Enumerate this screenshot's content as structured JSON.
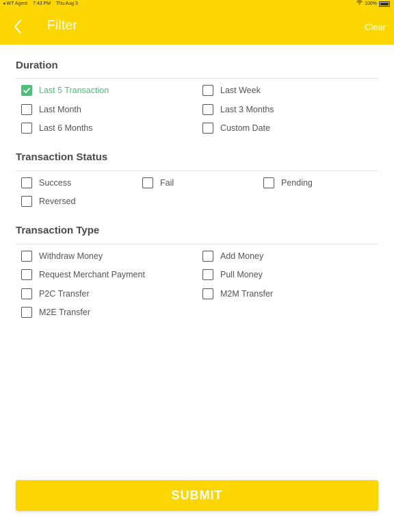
{
  "status_bar": {
    "carrier": "◂ WT Agent",
    "time": "7:43 PM",
    "date": "Thu Aug 3",
    "battery": "100%"
  },
  "header": {
    "title": "Filter",
    "clear_label": "Clear",
    "back_icon": "chevron-left-icon"
  },
  "colors": {
    "accent": "#FBD603",
    "checked": "#4FBE79",
    "text": "#555555"
  },
  "duration": {
    "title": "Duration",
    "options": [
      {
        "label": "Last 5 Transaction",
        "checked": true
      },
      {
        "label": "Last Week",
        "checked": false
      },
      {
        "label": "Last Month",
        "checked": false
      },
      {
        "label": "Last 3 Months",
        "checked": false
      },
      {
        "label": "Last 6 Months",
        "checked": false
      },
      {
        "label": "Custom Date",
        "checked": false
      }
    ]
  },
  "status": {
    "title": "Transaction Status",
    "options": [
      {
        "label": "Success",
        "checked": false
      },
      {
        "label": "Fail",
        "checked": false
      },
      {
        "label": "Pending",
        "checked": false
      },
      {
        "label": "Reversed",
        "checked": false
      }
    ]
  },
  "type": {
    "title": "Transaction Type",
    "options": [
      {
        "label": "Withdraw Money",
        "checked": false
      },
      {
        "label": "Add Money",
        "checked": false
      },
      {
        "label": "Request Merchant Payment",
        "checked": false
      },
      {
        "label": "Pull Money",
        "checked": false
      },
      {
        "label": "P2C Transfer",
        "checked": false
      },
      {
        "label": "M2M Transfer",
        "checked": false
      },
      {
        "label": "M2E Transfer",
        "checked": false
      }
    ]
  },
  "submit_label": "SUBMIT"
}
